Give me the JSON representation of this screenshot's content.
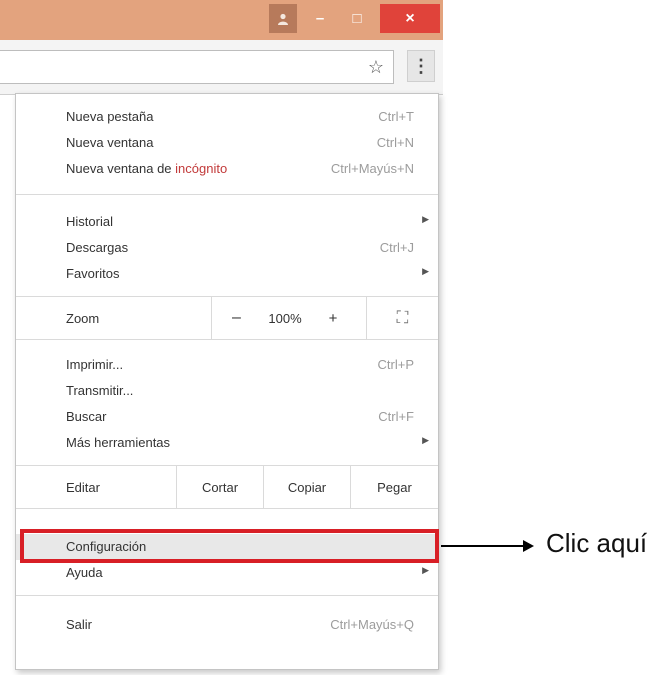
{
  "window": {
    "user_icon": "person-icon",
    "minimize_label": "–",
    "maximize_label": "□",
    "close_label": "×"
  },
  "toolbar": {
    "star_icon": "☆",
    "menu_icon": "⋮"
  },
  "menu": {
    "new_tab": {
      "label": "Nueva pestaña",
      "shortcut": "Ctrl+T"
    },
    "new_window": {
      "label": "Nueva ventana",
      "shortcut": "Ctrl+N"
    },
    "incognito": {
      "label_prefix": "Nueva ventana de ",
      "label_highlight": "incógnito",
      "shortcut": "Ctrl+Mayús+N"
    },
    "history": {
      "label": "Historial",
      "arrow": "▶"
    },
    "downloads": {
      "label": "Descargas",
      "shortcut": "Ctrl+J"
    },
    "bookmarks": {
      "label": "Favoritos",
      "arrow": "▶"
    },
    "zoom": {
      "label": "Zoom",
      "minus": "–",
      "value": "100%",
      "plus": "+",
      "fullscreen": "⛶"
    },
    "print": {
      "label": "Imprimir...",
      "shortcut": "Ctrl+P"
    },
    "cast": {
      "label": "Transmitir..."
    },
    "find": {
      "label": "Buscar",
      "shortcut": "Ctrl+F"
    },
    "more_tools": {
      "label": "Más herramientas",
      "arrow": "▶"
    },
    "edit": {
      "label": "Editar",
      "cut": "Cortar",
      "copy": "Copiar",
      "paste": "Pegar"
    },
    "settings": {
      "label": "Configuración"
    },
    "help": {
      "label": "Ayuda",
      "arrow": "▶"
    },
    "exit": {
      "label": "Salir",
      "shortcut": "Ctrl+Mayús+Q"
    }
  },
  "annotation": {
    "callout_text": "Clic aquí",
    "highlight_color": "#d81f26"
  }
}
